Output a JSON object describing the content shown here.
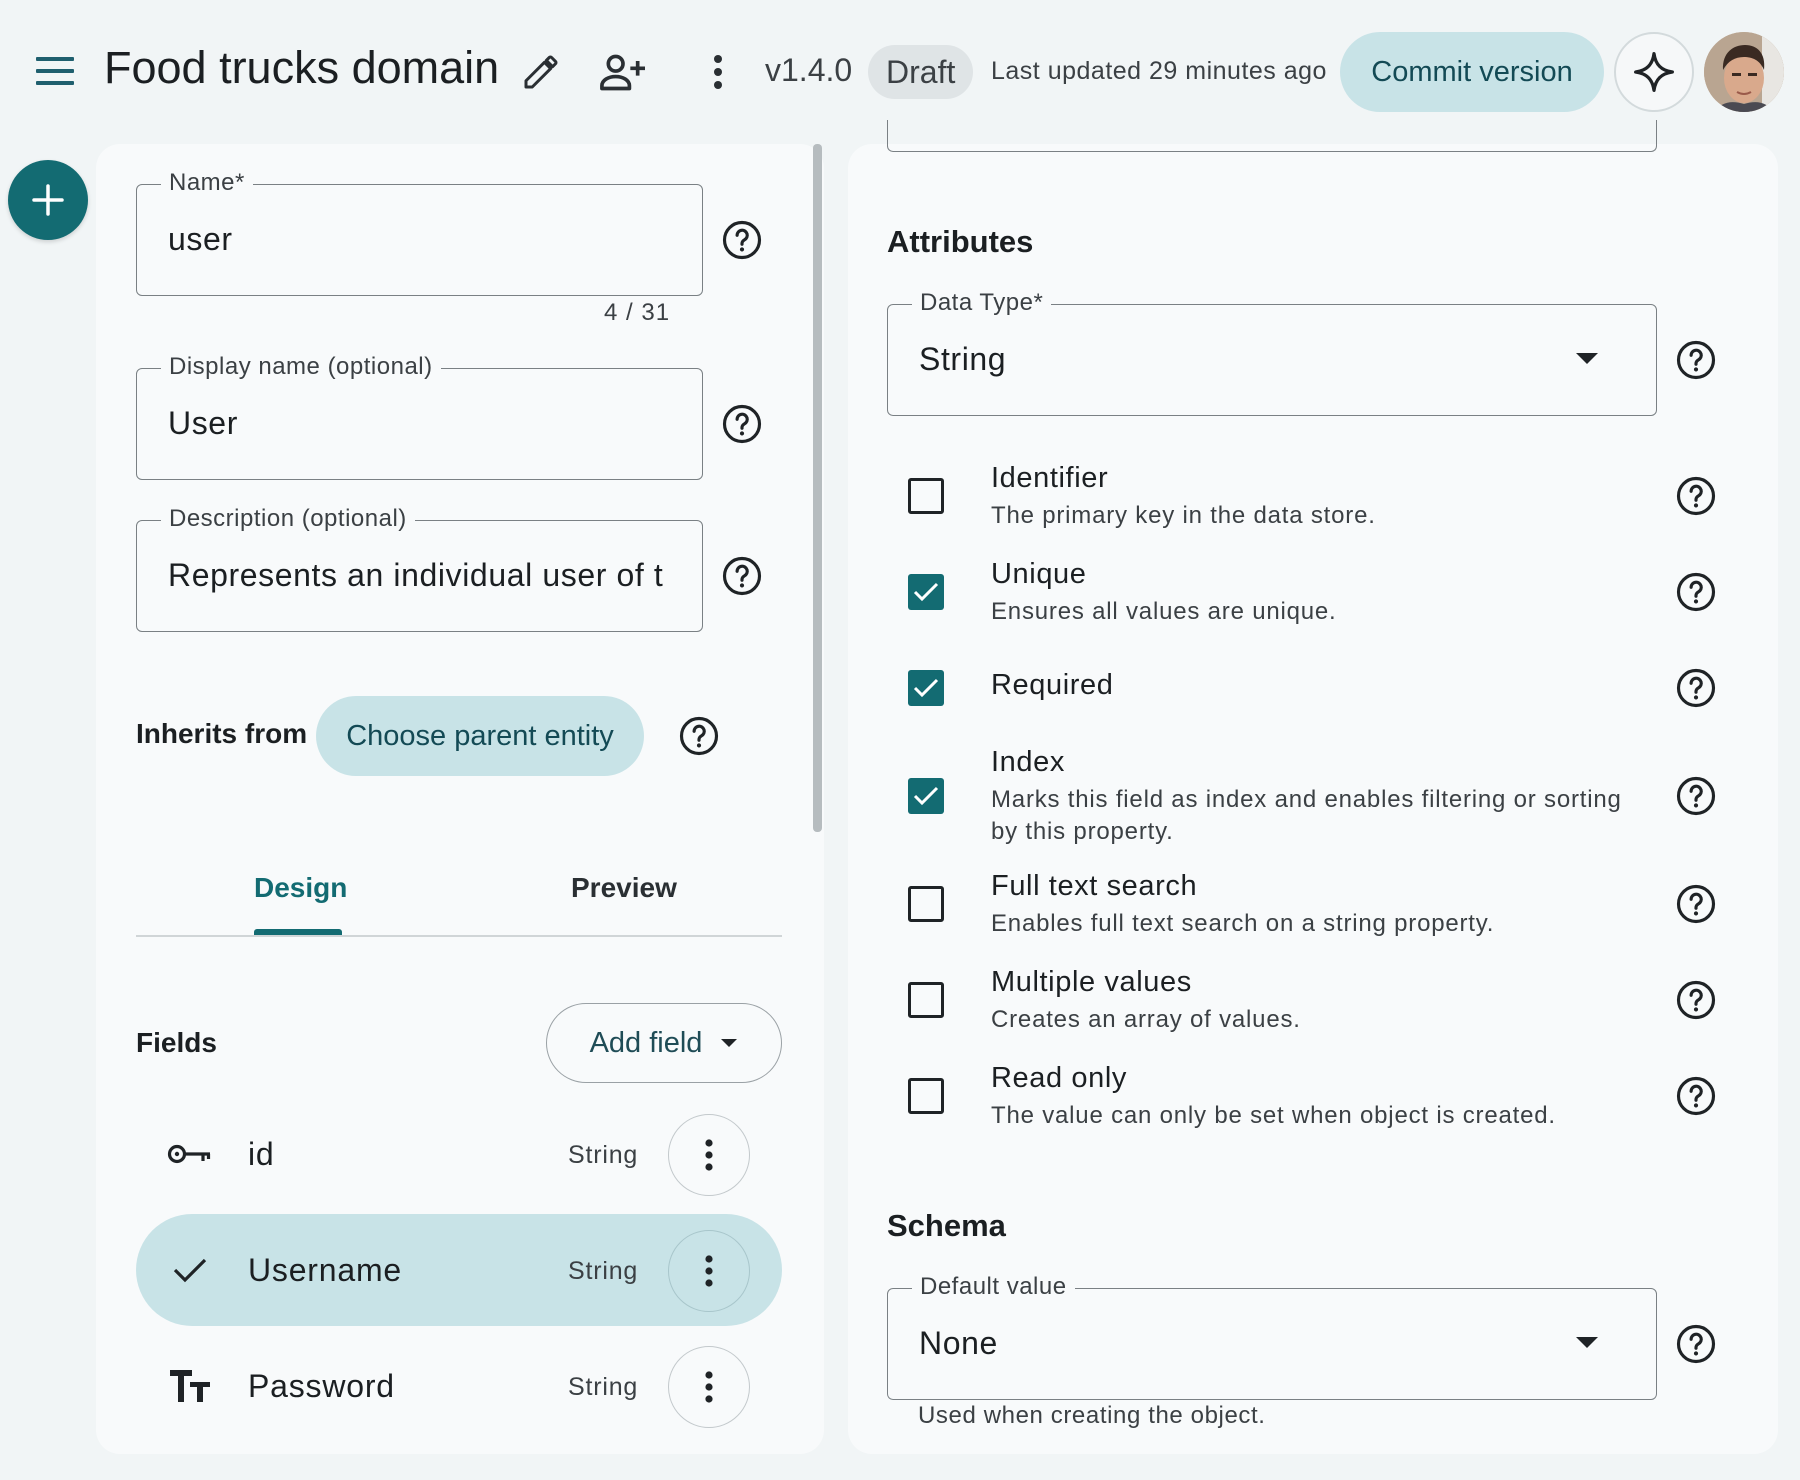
{
  "header": {
    "app_title": "Food trucks domain",
    "version": "v1.4.0",
    "status_badge": "Draft",
    "last_updated": "Last updated 29 minutes ago",
    "commit_label": "Commit version"
  },
  "entity_form": {
    "name": {
      "label": "Name*",
      "value": "user",
      "counter": "4 / 31"
    },
    "display_name": {
      "label": "Display name (optional)",
      "value": "User"
    },
    "description": {
      "label": "Description (optional)",
      "value": "Represents an individual user of t"
    },
    "inherits_label": "Inherits from",
    "choose_parent_label": "Choose parent entity"
  },
  "tabs": [
    {
      "label": "Design",
      "active": true
    },
    {
      "label": "Preview",
      "active": false
    }
  ],
  "fields_section": {
    "title": "Fields",
    "add_field_label": "Add field",
    "rows": [
      {
        "name": "id",
        "type": "String",
        "icon": "key-icon",
        "selected": false
      },
      {
        "name": "Username",
        "type": "String",
        "icon": "check-icon",
        "selected": true
      },
      {
        "name": "Password",
        "type": "String",
        "icon": "text-type-icon",
        "selected": false
      }
    ]
  },
  "attributes": {
    "title": "Attributes",
    "data_type": {
      "label": "Data Type*",
      "value": "String"
    },
    "options": [
      {
        "title": "Identifier",
        "description": "The primary key in the data store.",
        "checked": false
      },
      {
        "title": "Unique",
        "description": "Ensures all values are unique.",
        "checked": true
      },
      {
        "title": "Required",
        "description": "",
        "checked": true
      },
      {
        "title": "Index",
        "description": "Marks this field as index and enables filtering or sorting by this property.",
        "checked": true
      },
      {
        "title": "Full text search",
        "description": "Enables full text search on a string property.",
        "checked": false
      },
      {
        "title": "Multiple values",
        "description": "Creates an array of values.",
        "checked": false
      },
      {
        "title": "Read only",
        "description": "The value can only be set when object is created.",
        "checked": false
      }
    ]
  },
  "schema": {
    "title": "Schema",
    "default_value": {
      "label": "Default value",
      "value": "None",
      "helper": "Used when creating the object."
    }
  },
  "colors": {
    "accent": "#136b72",
    "tonal": "#c8e3e7",
    "background": "#f1f5f6",
    "surface": "#f8fafb"
  }
}
